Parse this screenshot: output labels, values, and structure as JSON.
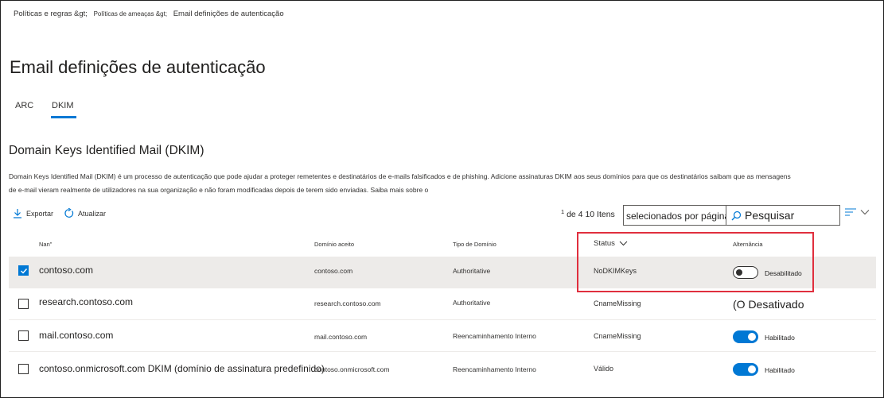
{
  "breadcrumb": {
    "item1": "Políticas e regras &gt;",
    "item2": "Políticas de ameaças &gt;",
    "item3": "Email definições de autenticação"
  },
  "page": {
    "title": "Email definições de autenticação"
  },
  "tabs": [
    {
      "label": "ARC",
      "active": false
    },
    {
      "label": "DKIM",
      "active": true
    }
  ],
  "section": {
    "title": "Domain Keys Identified Mail (DKIM)",
    "description_line1": "Domain Keys Identified Mail (DKIM) é um processo de autenticação que pode ajudar a proteger remetentes e destinatários de e-mails falsificados e de phishing. Adicione assinaturas DKIM aos seus domínios para que os destinatários saibam que as mensagens",
    "description_line2": "de e-mail vieram realmente de utilizadores na sua organização e não foram modificadas depois de terem sido enviadas.  Saiba mais sobre o"
  },
  "toolbar": {
    "export_label": "Exportar",
    "refresh_label": "Atualizar",
    "export_icon": "download-icon",
    "refresh_icon": "refresh-icon",
    "filter_icon": "filter-lines-icon"
  },
  "pagination": {
    "superscript": "1",
    "text": " de 4 10 Itens",
    "per_page_text": "selecionados por página"
  },
  "search": {
    "placeholder": "Pesquisar",
    "icon": "search-icon"
  },
  "table": {
    "headers": {
      "name": "Nan\"",
      "domain": "Domínio aceito",
      "type": "Tipo de Domínio",
      "status": "Status",
      "toggle": "Alternância"
    },
    "rows": [
      {
        "name": "contoso.com",
        "domain": "contoso.com",
        "type": "Authoritative",
        "status": "NoDKIMKeys",
        "toggle_label": "Desabilitado",
        "enabled": false,
        "selected": true
      },
      {
        "name": "research.contoso.com",
        "domain": "research.contoso.com",
        "type": "Authoritative",
        "status": "CnameMissing",
        "toggle_label": "(O Desativado",
        "enabled": false,
        "selected": false
      },
      {
        "name": "mail.contoso.com",
        "domain": "mail.contoso.com",
        "type": "Reencaminhamento Interno",
        "status": "CnameMissing",
        "toggle_label": "Habilitado",
        "enabled": true,
        "selected": false
      },
      {
        "name": "contoso.onmicrosoft.com DKIM (domínio de assinatura predefinido)",
        "domain": "contoso.onmicrosoft.com",
        "type": "Reencaminhamento Interno",
        "status": "Válido",
        "toggle_label": "Habilitado",
        "enabled": true,
        "selected": false
      }
    ]
  },
  "colors": {
    "accent": "#0078d4",
    "highlight_box": "#e02f3e",
    "selected_row": "#edebe9"
  }
}
